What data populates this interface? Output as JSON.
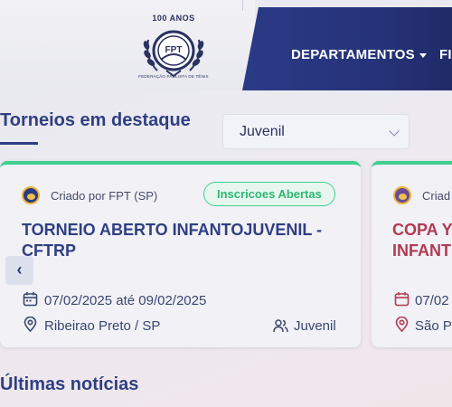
{
  "header": {
    "logo_anos": "100 ANOS",
    "logo_monogram": "FPT",
    "logo_caption": "FEDERAÇÃO PAULISTA DE TÊNIS",
    "nav": [
      {
        "label": "DEPARTAMENTOS"
      },
      {
        "label": "FI"
      }
    ]
  },
  "featured": {
    "title": "Torneios em destaque",
    "filter": {
      "selected": "Juvenil"
    },
    "prev_label": "‹"
  },
  "cards": [
    {
      "organizer": "Criado por FPT (SP)",
      "badge": "Inscricoes Abertas",
      "title": "TORNEIO ABERTO INFANTOJUVENIL - CFTRP",
      "dates": "07/02/2025 até 09/02/2025",
      "location": "Ribeirao Preto / SP",
      "category": "Juvenil"
    },
    {
      "organizer": "Criad",
      "title": "COPA Y\nINFANT",
      "dates": "07/02",
      "location": "São P"
    }
  ],
  "news": {
    "title": "Últimas notícias"
  },
  "colors": {
    "primary": "#2f3f82",
    "accent_green": "#3fcf8e",
    "title_red": "#b13b52",
    "nav_bg": "#2b3a86"
  }
}
